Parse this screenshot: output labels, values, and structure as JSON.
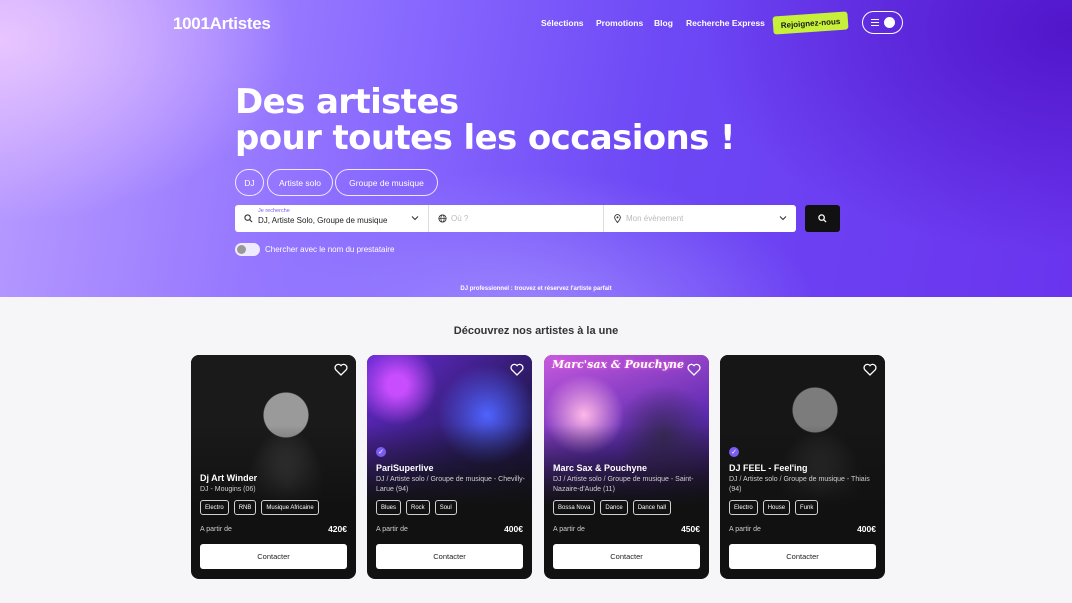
{
  "brand": {
    "logo": "1001Artistes"
  },
  "nav": {
    "items": [
      "Sélections",
      "Promotions",
      "Blog",
      "Recherche Express"
    ],
    "join_label": "Rejoignez-nous"
  },
  "hero": {
    "headline_line1": "Des artistes",
    "headline_line2": "pour toutes les occasions !",
    "chips": [
      "DJ",
      "Artiste solo",
      "Groupe de musique"
    ],
    "search": {
      "what_label": "Je recherche",
      "what_value": "DJ, Artiste Solo, Groupe de musique",
      "where_placeholder": "Où ?",
      "event_placeholder": "Mon évènement"
    },
    "toggle_label": "Chercher avec le nom du prestataire",
    "tagline": "DJ professionnel : trouvez et réservez l'artiste parfait"
  },
  "featured": {
    "title": "Découvrez nos artistes à la une",
    "from_label": "A partir de",
    "contact_label": "Contacter",
    "cards": [
      {
        "name": "Dj Art Winder",
        "meta": "DJ - Mougins (06)",
        "tags": [
          "Electro",
          "RNB",
          "Musique Africaine"
        ],
        "price": "420€",
        "verified": false
      },
      {
        "name": "PariSuperlive",
        "meta": "DJ / Artiste solo / Groupe de musique - Chevilly-Larue (94)",
        "tags": [
          "Blues",
          "Rock",
          "Soul"
        ],
        "price": "400€",
        "verified": true
      },
      {
        "name": "Marc Sax & Pouchyne",
        "meta": "DJ / Artiste solo / Groupe de musique - Saint-Nazaire-d'Aude (11)",
        "tags": [
          "Bossa Nova",
          "Dance",
          "Dance hall"
        ],
        "price": "450€",
        "verified": false,
        "photo_text": "Marc'sax & Pouchyne"
      },
      {
        "name": "DJ FEEL - Feel'ing",
        "meta": "DJ / Artiste solo / Groupe de musique - Thiais (94)",
        "tags": [
          "Electro",
          "House",
          "Funk"
        ],
        "price": "400€",
        "verified": true
      }
    ]
  },
  "colors": {
    "accent": "#7b5cf0",
    "join": "#c7f03a",
    "search_button": "#111111"
  }
}
